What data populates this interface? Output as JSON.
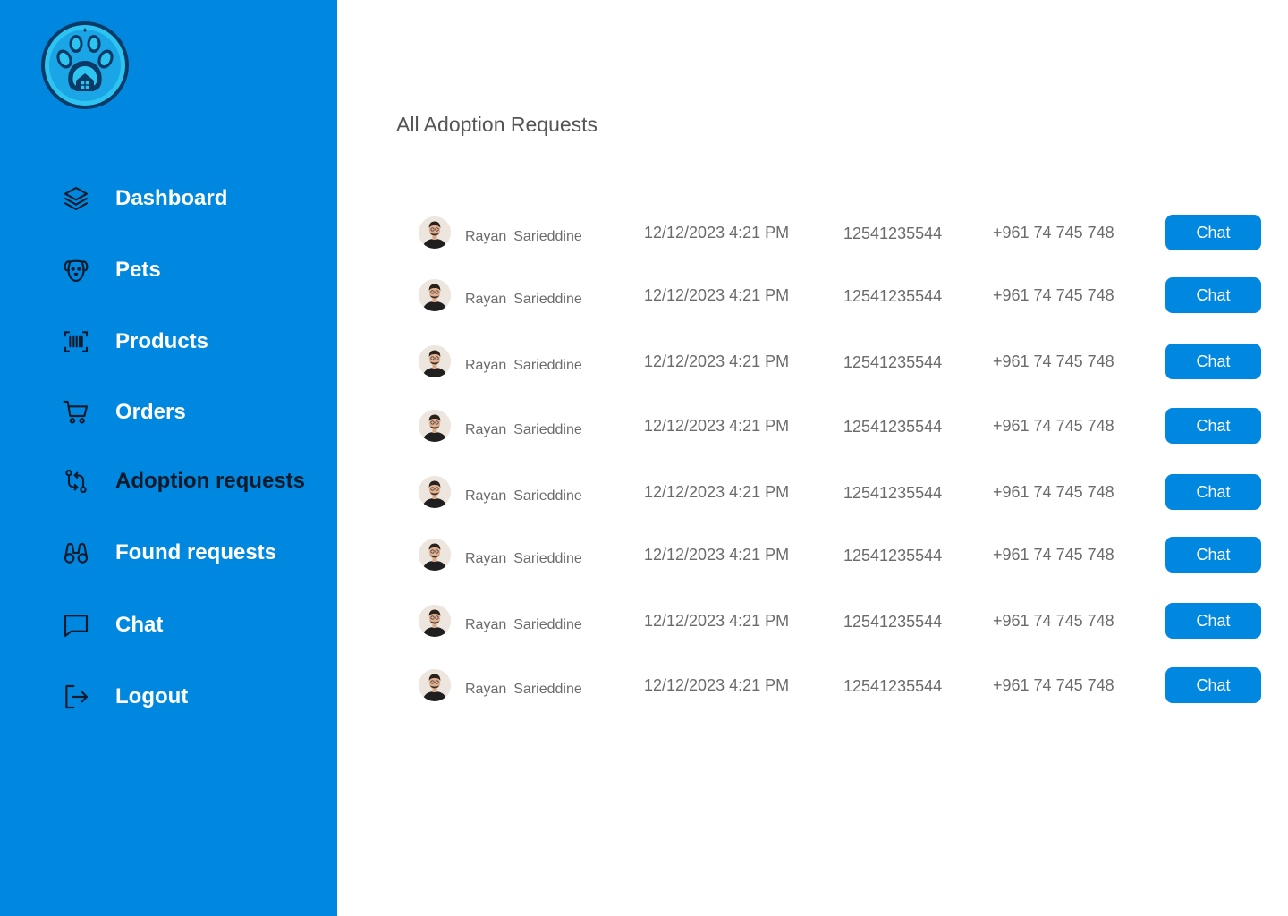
{
  "sidebar": {
    "items": [
      {
        "label": "Dashboard",
        "icon": "layers-icon"
      },
      {
        "label": "Pets",
        "icon": "dog-icon"
      },
      {
        "label": "Products",
        "icon": "barcode-icon"
      },
      {
        "label": "Orders",
        "icon": "cart-icon"
      },
      {
        "label": "Adoption requests",
        "icon": "git-compare-icon",
        "active": true
      },
      {
        "label": "Found requests",
        "icon": "binoculars-icon"
      },
      {
        "label": "Chat",
        "icon": "message-icon"
      },
      {
        "label": "Logout",
        "icon": "logout-icon"
      }
    ]
  },
  "main": {
    "title": "All Adoption Requests",
    "requests": [
      {
        "first": "Rayan",
        "last": "Sarieddine",
        "date": "12/12/2023 4:21 PM",
        "id": "12541235544",
        "phone": "+961 74 745 748",
        "action": "Chat"
      },
      {
        "first": "Rayan",
        "last": "Sarieddine",
        "date": "12/12/2023 4:21 PM",
        "id": "12541235544",
        "phone": "+961 74 745 748",
        "action": "Chat"
      },
      {
        "first": "Rayan",
        "last": "Sarieddine",
        "date": "12/12/2023 4:21 PM",
        "id": "12541235544",
        "phone": "+961 74 745 748",
        "action": "Chat"
      },
      {
        "first": "Rayan",
        "last": "Sarieddine",
        "date": "12/12/2023 4:21 PM",
        "id": "12541235544",
        "phone": "+961 74 745 748",
        "action": "Chat"
      },
      {
        "first": "Rayan",
        "last": "Sarieddine",
        "date": "12/12/2023 4:21 PM",
        "id": "12541235544",
        "phone": "+961 74 745 748",
        "action": "Chat"
      },
      {
        "first": "Rayan",
        "last": "Sarieddine",
        "date": "12/12/2023 4:21 PM",
        "id": "12541235544",
        "phone": "+961 74 745 748",
        "action": "Chat"
      },
      {
        "first": "Rayan",
        "last": "Sarieddine",
        "date": "12/12/2023 4:21 PM",
        "id": "12541235544",
        "phone": "+961 74 745 748",
        "action": "Chat"
      },
      {
        "first": "Rayan",
        "last": "Sarieddine",
        "date": "12/12/2023 4:21 PM",
        "id": "12541235544",
        "phone": "+961 74 745 748",
        "action": "Chat"
      }
    ]
  },
  "colors": {
    "accent": "#0088e0",
    "text_muted": "#6b6b6b",
    "active_nav": "#0b1b2b"
  }
}
